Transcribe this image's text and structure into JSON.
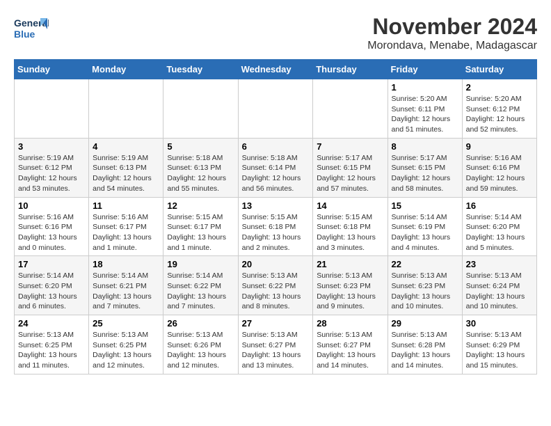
{
  "logo": {
    "line1": "General",
    "line2": "Blue"
  },
  "title": "November 2024",
  "subtitle": "Morondava, Menabe, Madagascar",
  "weekdays": [
    "Sunday",
    "Monday",
    "Tuesday",
    "Wednesday",
    "Thursday",
    "Friday",
    "Saturday"
  ],
  "weeks": [
    [
      {
        "day": "",
        "info": ""
      },
      {
        "day": "",
        "info": ""
      },
      {
        "day": "",
        "info": ""
      },
      {
        "day": "",
        "info": ""
      },
      {
        "day": "",
        "info": ""
      },
      {
        "day": "1",
        "info": "Sunrise: 5:20 AM\nSunset: 6:11 PM\nDaylight: 12 hours\nand 51 minutes."
      },
      {
        "day": "2",
        "info": "Sunrise: 5:20 AM\nSunset: 6:12 PM\nDaylight: 12 hours\nand 52 minutes."
      }
    ],
    [
      {
        "day": "3",
        "info": "Sunrise: 5:19 AM\nSunset: 6:12 PM\nDaylight: 12 hours\nand 53 minutes."
      },
      {
        "day": "4",
        "info": "Sunrise: 5:19 AM\nSunset: 6:13 PM\nDaylight: 12 hours\nand 54 minutes."
      },
      {
        "day": "5",
        "info": "Sunrise: 5:18 AM\nSunset: 6:13 PM\nDaylight: 12 hours\nand 55 minutes."
      },
      {
        "day": "6",
        "info": "Sunrise: 5:18 AM\nSunset: 6:14 PM\nDaylight: 12 hours\nand 56 minutes."
      },
      {
        "day": "7",
        "info": "Sunrise: 5:17 AM\nSunset: 6:15 PM\nDaylight: 12 hours\nand 57 minutes."
      },
      {
        "day": "8",
        "info": "Sunrise: 5:17 AM\nSunset: 6:15 PM\nDaylight: 12 hours\nand 58 minutes."
      },
      {
        "day": "9",
        "info": "Sunrise: 5:16 AM\nSunset: 6:16 PM\nDaylight: 12 hours\nand 59 minutes."
      }
    ],
    [
      {
        "day": "10",
        "info": "Sunrise: 5:16 AM\nSunset: 6:16 PM\nDaylight: 13 hours\nand 0 minutes."
      },
      {
        "day": "11",
        "info": "Sunrise: 5:16 AM\nSunset: 6:17 PM\nDaylight: 13 hours\nand 1 minute."
      },
      {
        "day": "12",
        "info": "Sunrise: 5:15 AM\nSunset: 6:17 PM\nDaylight: 13 hours\nand 1 minute."
      },
      {
        "day": "13",
        "info": "Sunrise: 5:15 AM\nSunset: 6:18 PM\nDaylight: 13 hours\nand 2 minutes."
      },
      {
        "day": "14",
        "info": "Sunrise: 5:15 AM\nSunset: 6:18 PM\nDaylight: 13 hours\nand 3 minutes."
      },
      {
        "day": "15",
        "info": "Sunrise: 5:14 AM\nSunset: 6:19 PM\nDaylight: 13 hours\nand 4 minutes."
      },
      {
        "day": "16",
        "info": "Sunrise: 5:14 AM\nSunset: 6:20 PM\nDaylight: 13 hours\nand 5 minutes."
      }
    ],
    [
      {
        "day": "17",
        "info": "Sunrise: 5:14 AM\nSunset: 6:20 PM\nDaylight: 13 hours\nand 6 minutes."
      },
      {
        "day": "18",
        "info": "Sunrise: 5:14 AM\nSunset: 6:21 PM\nDaylight: 13 hours\nand 7 minutes."
      },
      {
        "day": "19",
        "info": "Sunrise: 5:14 AM\nSunset: 6:22 PM\nDaylight: 13 hours\nand 7 minutes."
      },
      {
        "day": "20",
        "info": "Sunrise: 5:13 AM\nSunset: 6:22 PM\nDaylight: 13 hours\nand 8 minutes."
      },
      {
        "day": "21",
        "info": "Sunrise: 5:13 AM\nSunset: 6:23 PM\nDaylight: 13 hours\nand 9 minutes."
      },
      {
        "day": "22",
        "info": "Sunrise: 5:13 AM\nSunset: 6:23 PM\nDaylight: 13 hours\nand 10 minutes."
      },
      {
        "day": "23",
        "info": "Sunrise: 5:13 AM\nSunset: 6:24 PM\nDaylight: 13 hours\nand 10 minutes."
      }
    ],
    [
      {
        "day": "24",
        "info": "Sunrise: 5:13 AM\nSunset: 6:25 PM\nDaylight: 13 hours\nand 11 minutes."
      },
      {
        "day": "25",
        "info": "Sunrise: 5:13 AM\nSunset: 6:25 PM\nDaylight: 13 hours\nand 12 minutes."
      },
      {
        "day": "26",
        "info": "Sunrise: 5:13 AM\nSunset: 6:26 PM\nDaylight: 13 hours\nand 12 minutes."
      },
      {
        "day": "27",
        "info": "Sunrise: 5:13 AM\nSunset: 6:27 PM\nDaylight: 13 hours\nand 13 minutes."
      },
      {
        "day": "28",
        "info": "Sunrise: 5:13 AM\nSunset: 6:27 PM\nDaylight: 13 hours\nand 14 minutes."
      },
      {
        "day": "29",
        "info": "Sunrise: 5:13 AM\nSunset: 6:28 PM\nDaylight: 13 hours\nand 14 minutes."
      },
      {
        "day": "30",
        "info": "Sunrise: 5:13 AM\nSunset: 6:29 PM\nDaylight: 13 hours\nand 15 minutes."
      }
    ]
  ]
}
